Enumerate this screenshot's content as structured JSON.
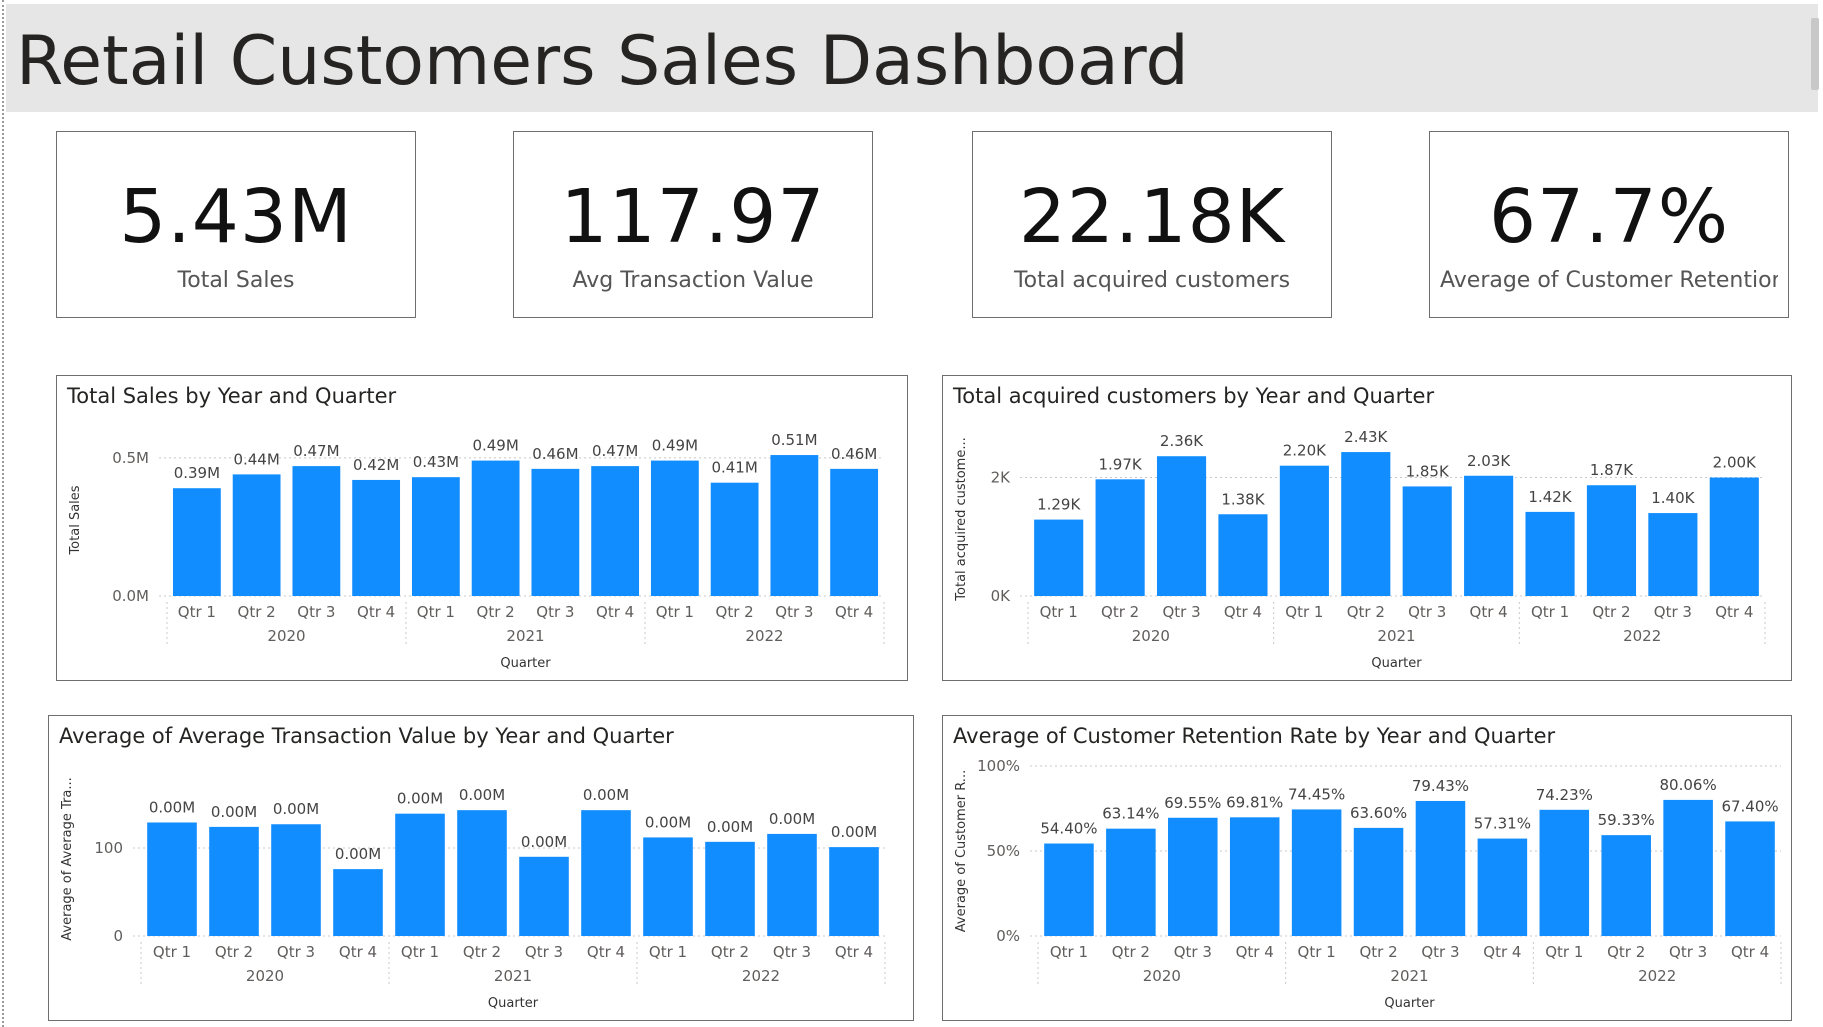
{
  "header": {
    "title": "Retail Customers Sales Dashboard"
  },
  "kpis": [
    {
      "value": "5.43M",
      "label": "Total Sales"
    },
    {
      "value": "117.97",
      "label": "Avg Transaction Value"
    },
    {
      "value": "22.18K",
      "label": "Total acquired customers"
    },
    {
      "value": "67.7%",
      "label": "Average of Customer Retention ..."
    }
  ],
  "colors": {
    "bar": "#118DFF",
    "grid": "#c8c8c8",
    "text": "#605e5c"
  },
  "chart_data": [
    {
      "type": "bar",
      "title": "Total Sales by Year and Quarter",
      "xlabel": "Quarter",
      "ylabel": "Total Sales",
      "categories": [
        "Qtr 1",
        "Qtr 2",
        "Qtr 3",
        "Qtr 4",
        "Qtr 1",
        "Qtr 2",
        "Qtr 3",
        "Qtr 4",
        "Qtr 1",
        "Qtr 2",
        "Qtr 3",
        "Qtr 4"
      ],
      "years": [
        "2020",
        "2021",
        "2022"
      ],
      "values": [
        0.39,
        0.44,
        0.47,
        0.42,
        0.43,
        0.49,
        0.46,
        0.47,
        0.49,
        0.41,
        0.51,
        0.46
      ],
      "data_labels": [
        "0.39M",
        "0.44M",
        "0.47M",
        "0.42M",
        "0.43M",
        "0.49M",
        "0.46M",
        "0.47M",
        "0.49M",
        "0.41M",
        "0.51M",
        "0.46M"
      ],
      "yticks": [
        0,
        0.5
      ],
      "ytick_labels": [
        "0.0M",
        "0.5M"
      ],
      "ylim": [
        0,
        0.55
      ]
    },
    {
      "type": "bar",
      "title": "Total acquired customers by Year and Quarter",
      "xlabel": "Quarter",
      "ylabel": "Total acquired custome...",
      "categories": [
        "Qtr 1",
        "Qtr 2",
        "Qtr 3",
        "Qtr 4",
        "Qtr 1",
        "Qtr 2",
        "Qtr 3",
        "Qtr 4",
        "Qtr 1",
        "Qtr 2",
        "Qtr 3",
        "Qtr 4"
      ],
      "years": [
        "2020",
        "2021",
        "2022"
      ],
      "values": [
        1290,
        1970,
        2360,
        1380,
        2200,
        2430,
        1850,
        2030,
        1420,
        1870,
        1400,
        2000
      ],
      "data_labels": [
        "1.29K",
        "1.97K",
        "2.36K",
        "1.38K",
        "2.20K",
        "2.43K",
        "1.85K",
        "2.03K",
        "1.42K",
        "1.87K",
        "1.40K",
        "2.00K"
      ],
      "yticks": [
        0,
        2000
      ],
      "ytick_labels": [
        "0K",
        "2K"
      ],
      "ylim": [
        0,
        2600
      ]
    },
    {
      "type": "bar",
      "title": "Average of Average Transaction Value by Year and Quarter",
      "xlabel": "Quarter",
      "ylabel": "Average of Average Tra...",
      "categories": [
        "Qtr 1",
        "Qtr 2",
        "Qtr 3",
        "Qtr 4",
        "Qtr 1",
        "Qtr 2",
        "Qtr 3",
        "Qtr 4",
        "Qtr 1",
        "Qtr 2",
        "Qtr 3",
        "Qtr 4"
      ],
      "years": [
        "2020",
        "2021",
        "2022"
      ],
      "values": [
        129,
        124,
        127,
        76,
        139,
        143,
        90,
        143,
        112,
        107,
        116,
        101
      ],
      "data_labels": [
        "0.00M",
        "0.00M",
        "0.00M",
        "0.00M",
        "0.00M",
        "0.00M",
        "0.00M",
        "0.00M",
        "0.00M",
        "0.00M",
        "0.00M",
        "0.00M"
      ],
      "yticks": [
        0,
        100
      ],
      "ytick_labels": [
        "0",
        "100"
      ],
      "ylim": [
        0,
        175
      ]
    },
    {
      "type": "bar",
      "title": "Average of Customer Retention Rate by Year and Quarter",
      "xlabel": "Quarter",
      "ylabel": "Average of Customer R...",
      "categories": [
        "Qtr 1",
        "Qtr 2",
        "Qtr 3",
        "Qtr 4",
        "Qtr 1",
        "Qtr 2",
        "Qtr 3",
        "Qtr 4",
        "Qtr 1",
        "Qtr 2",
        "Qtr 3",
        "Qtr 4"
      ],
      "years": [
        "2020",
        "2021",
        "2022"
      ],
      "values": [
        54.4,
        63.14,
        69.55,
        69.81,
        74.45,
        63.6,
        79.43,
        57.31,
        74.23,
        59.33,
        80.06,
        67.4
      ],
      "data_labels": [
        "54.40%",
        "63.14%",
        "69.55%",
        "69.81%",
        "74.45%",
        "63.60%",
        "79.43%",
        "57.31%",
        "74.23%",
        "59.33%",
        "80.06%",
        "67.40%"
      ],
      "yticks": [
        0,
        50,
        100
      ],
      "ytick_labels": [
        "0%",
        "50%",
        "100%"
      ],
      "ylim": [
        0,
        100
      ]
    }
  ]
}
